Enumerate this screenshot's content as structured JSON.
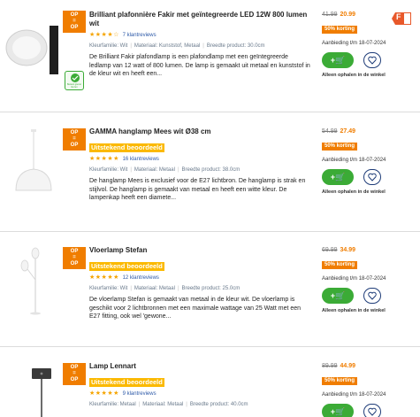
{
  "products": [
    {
      "badge": [
        "OP",
        "=",
        "OP"
      ],
      "title": "Brilliant plafonnière Fakir met geïntegreerde LED 12W 800 lumen wit",
      "tag": "",
      "stars": "★★★★☆",
      "reviews": "7 klantreviews",
      "specs": [
        "Kleurfamilie: Wit",
        "Materiaal: Kunststof, Metaal",
        "Breedte product: 30.0cm"
      ],
      "description": "De Brilliant Fakir plafondlamp is een plafondlamp met een geïntegreerde ledlamp van 12 watt of 800 lumen. De lamp is gemaakt uit metaal en kunststof in de kleur wit en heeft een...",
      "old_price": "41.99",
      "new_price": "20.99",
      "discount": "50% korting",
      "offer": "Aanbieding t/m 18-07-2024",
      "cart_label": "+🛒",
      "pickup": "Alleen ophalen in de winkel",
      "energy_label": "F",
      "eco_label": "Bewust grener kiezen"
    },
    {
      "badge": [
        "OP",
        "=",
        "OP"
      ],
      "title": "GAMMA hanglamp Mees wit Ø38 cm",
      "tag": "Uitstekend beoordeeld",
      "stars": "★★★★★",
      "reviews": "16 klantreviews",
      "specs": [
        "Kleurfamilie: Wit",
        "Materiaal: Metaal",
        "Breedte product: 38.0cm"
      ],
      "description": "De hanglamp Mees is exclusief voor de E27 lichtbron. De hanglamp is strak en stijlvol. De hanglamp is gemaakt van metaal en heeft een witte kleur. De lampenkap heeft een diamete...",
      "old_price": "54.99",
      "new_price": "27.49",
      "discount": "50% korting",
      "offer": "Aanbieding t/m 18-07-2024",
      "cart_label": "+🛒",
      "pickup": "Alleen ophalen in de winkel"
    },
    {
      "badge": [
        "OP",
        "=",
        "OP"
      ],
      "title": "Vloerlamp Stefan",
      "tag": "Uitstekend beoordeeld",
      "stars": "★★★★★",
      "reviews": "12 klantreviews",
      "specs": [
        "Kleurfamilie: Wit",
        "Materiaal: Metaal",
        "Breedte product: 25.0cm"
      ],
      "description": "De vloerlamp Stefan is gemaakt van metaal in de kleur wit. De vloerlamp is geschikt voor 2 lichtbronnen met een maximale wattage van 25 Watt met een E27 fitting, ook wel 'gewone...",
      "old_price": "69.99",
      "new_price": "34.99",
      "discount": "50% korting",
      "offer": "Aanbieding t/m 18-07-2024",
      "cart_label": "+🛒",
      "pickup": "Alleen ophalen in de winkel"
    },
    {
      "badge": [
        "OP",
        "=",
        "OP"
      ],
      "title": "Lamp Lennart",
      "tag": "Uitstekend beoordeeld",
      "stars": "★★★★★",
      "reviews": "9 klantreviews",
      "specs": [
        "Kleurfamilie: Metaal",
        "Materiaal: Metaal",
        "Breedte product: 40.0cm"
      ],
      "description": "",
      "old_price": "89.99",
      "new_price": "44.99",
      "discount": "50% korting",
      "offer": "Aanbieding t/m 18-07-2024",
      "cart_label": "+🛒",
      "pickup": ""
    }
  ],
  "colors": {
    "accent": "#f07d00",
    "green": "#3bab36",
    "navy": "#1e3c78",
    "tag": "#fbb900"
  }
}
